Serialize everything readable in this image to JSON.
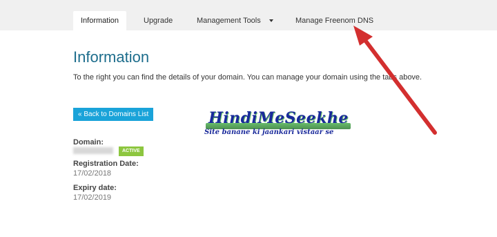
{
  "tabs": [
    {
      "label": "Information",
      "active": true
    },
    {
      "label": "Upgrade",
      "active": false
    },
    {
      "label": "Management Tools",
      "active": false,
      "has_dropdown": true
    },
    {
      "label": "Manage Freenom DNS",
      "active": false
    }
  ],
  "heading": "Information",
  "intro": "To the right you can find the details of your domain. You can manage your domain using the tabs above.",
  "back_button": "« Back to Domains List",
  "details": {
    "domain_label": "Domain:",
    "status_badge": "ACTIVE",
    "registration_label": "Registration Date:",
    "registration_value": "17/02/2018",
    "expiry_label": "Expiry date:",
    "expiry_value": "17/02/2019"
  },
  "watermark": {
    "title": "HindiMeSeekhe",
    "subtitle": "Site banane ki jaankari vistaar se"
  },
  "colors": {
    "accent": "#1aa3d9",
    "heading": "#1d6d8c",
    "badge": "#8dc63f",
    "annotation_arrow": "#d32f2f"
  }
}
